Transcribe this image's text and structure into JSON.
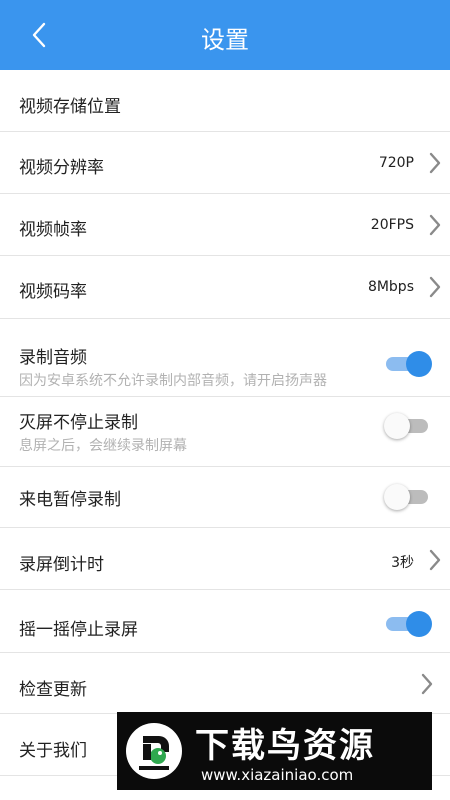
{
  "header": {
    "title": "设置",
    "back_icon": "back-icon"
  },
  "rows": {
    "storage": {
      "label": "视频存储位置"
    },
    "resolution": {
      "label": "视频分辨率",
      "value": "720P"
    },
    "framerate": {
      "label": "视频帧率",
      "value": "20FPS"
    },
    "bitrate": {
      "label": "视频码率",
      "value": "8Mbps"
    },
    "record_audio": {
      "label": "录制音频",
      "sub": "因为安卓系统不允许录制内部音频，请开启扬声器",
      "on": true
    },
    "screen_off": {
      "label": "灭屏不停止录制",
      "sub": "息屏之后，会继续录制屏幕",
      "on": false
    },
    "call_pause": {
      "label": "来电暂停录制",
      "on": false
    },
    "countdown": {
      "label": "录屏倒计时",
      "value": "3秒"
    },
    "shake_stop": {
      "label": "摇一摇停止录屏",
      "on": true
    },
    "check_update": {
      "label": "检查更新"
    },
    "about": {
      "label": "关于我们"
    }
  },
  "watermark": {
    "title": "下载鸟资源",
    "url": "www.xiazainiao.com"
  },
  "colors": {
    "accent": "#3a95ee",
    "toggle_on": "#2f8de8",
    "toggle_on_track": "#8cbcf0",
    "toggle_off_track": "#bcbcbc"
  }
}
